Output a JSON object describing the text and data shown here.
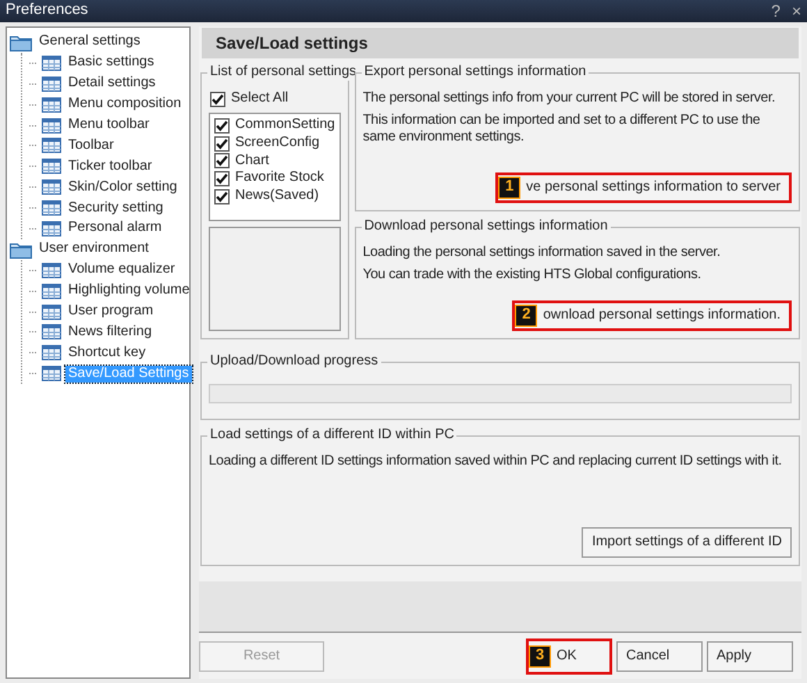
{
  "window": {
    "title": "Preferences",
    "controls": [
      "?",
      "×"
    ]
  },
  "tree": [
    {
      "label": "General settings",
      "selected": false,
      "children": [
        {
          "label": "Basic settings",
          "selected": false
        },
        {
          "label": "Detail settings",
          "selected": false
        },
        {
          "label": "Menu composition",
          "selected": false
        },
        {
          "label": "Menu toolbar",
          "selected": false
        },
        {
          "label": "Toolbar",
          "selected": false
        },
        {
          "label": "Ticker toolbar",
          "selected": false
        },
        {
          "label": "Skin/Color setting",
          "selected": false
        },
        {
          "label": "Security setting",
          "selected": false
        },
        {
          "label": "Personal alarm",
          "selected": false
        }
      ]
    },
    {
      "label": "User environment",
      "selected": false,
      "children": [
        {
          "label": "Volume equalizer",
          "selected": false
        },
        {
          "label": "Highlighting volume",
          "selected": false
        },
        {
          "label": "User program",
          "selected": false
        },
        {
          "label": "News filtering",
          "selected": false
        },
        {
          "label": "Shortcut key",
          "selected": false
        },
        {
          "label": "Save/Load Settings",
          "selected": true
        }
      ]
    }
  ],
  "panel": {
    "title": "Save/Load settings",
    "personal_list": {
      "title": "List of personal settings",
      "select_all": {
        "label": "Select All",
        "checked": true
      },
      "items": [
        {
          "label": "CommonSetting",
          "checked": true
        },
        {
          "label": "ScreenConfig",
          "checked": true
        },
        {
          "label": "Chart",
          "checked": true
        },
        {
          "label": "Favorite Stock",
          "checked": true
        },
        {
          "label": "News(Saved)",
          "checked": true
        }
      ]
    },
    "export": {
      "title": "Export personal settings information",
      "lines": [
        "The personal settings info from your current PC will be stored in server.",
        "This information can be imported and set to a different PC to use the same environment settings."
      ],
      "button": {
        "label": "ve personal settings information to server",
        "callout": "1"
      }
    },
    "download": {
      "title": "Download personal settings information",
      "lines": [
        "Loading the personal settings information saved in the server.",
        "You can trade with the existing HTS Global configurations."
      ],
      "button": {
        "label": "ownload personal settings information.",
        "callout": "2"
      }
    },
    "progress": {
      "title": "Upload/Download progress"
    },
    "load_other": {
      "title": "Load settings of a different ID within PC",
      "lines": [
        "Loading a different ID settings information saved within PC and replacing current ID settings with it."
      ],
      "button": {
        "label": "Import settings of a different ID"
      }
    }
  },
  "footer": {
    "reset": {
      "label": "Reset",
      "disabled": true
    },
    "buttons": [
      {
        "label": "OK",
        "callout": "3"
      },
      {
        "label": "Cancel"
      },
      {
        "label": "Apply"
      }
    ]
  }
}
